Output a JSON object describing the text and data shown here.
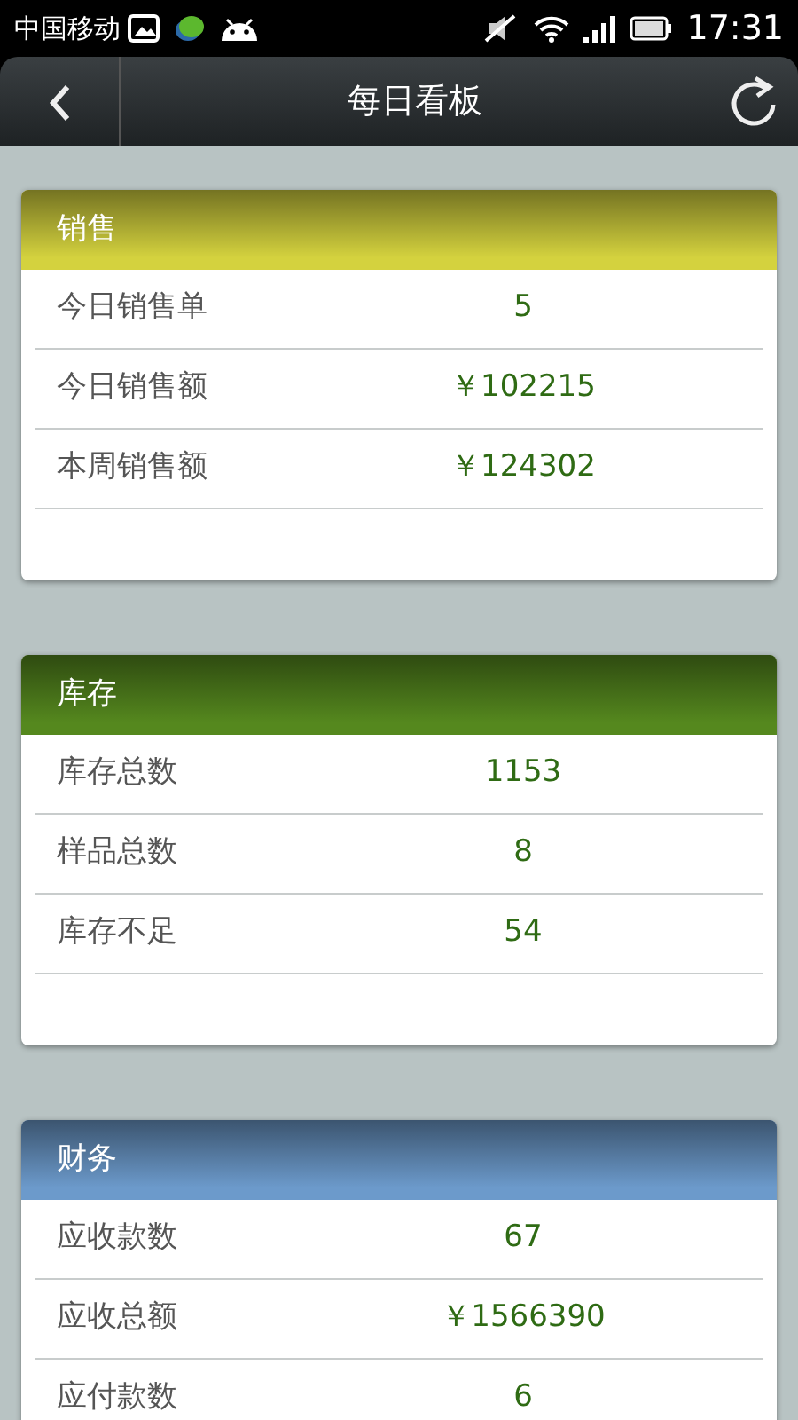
{
  "status_bar": {
    "carrier": "中国移动",
    "time": "17:31"
  },
  "header": {
    "title": "每日看板"
  },
  "cards": [
    {
      "title": "销售",
      "color": "#d4d23e",
      "rows": [
        {
          "label": "今日销售单",
          "value": "5"
        },
        {
          "label": "今日销售额",
          "value": "￥102215"
        },
        {
          "label": "本周销售额",
          "value": "￥124302"
        }
      ]
    },
    {
      "title": "库存",
      "color": "#55881e",
      "rows": [
        {
          "label": "库存总数",
          "value": "1153"
        },
        {
          "label": "样品总数",
          "value": "8"
        },
        {
          "label": "库存不足",
          "value": "54"
        }
      ]
    },
    {
      "title": "财务",
      "color": "#6c9acb",
      "rows": [
        {
          "label": "应收款数",
          "value": "67"
        },
        {
          "label": "应收总额",
          "value": "￥1566390"
        },
        {
          "label": "应付款数",
          "value": "6"
        }
      ]
    }
  ]
}
